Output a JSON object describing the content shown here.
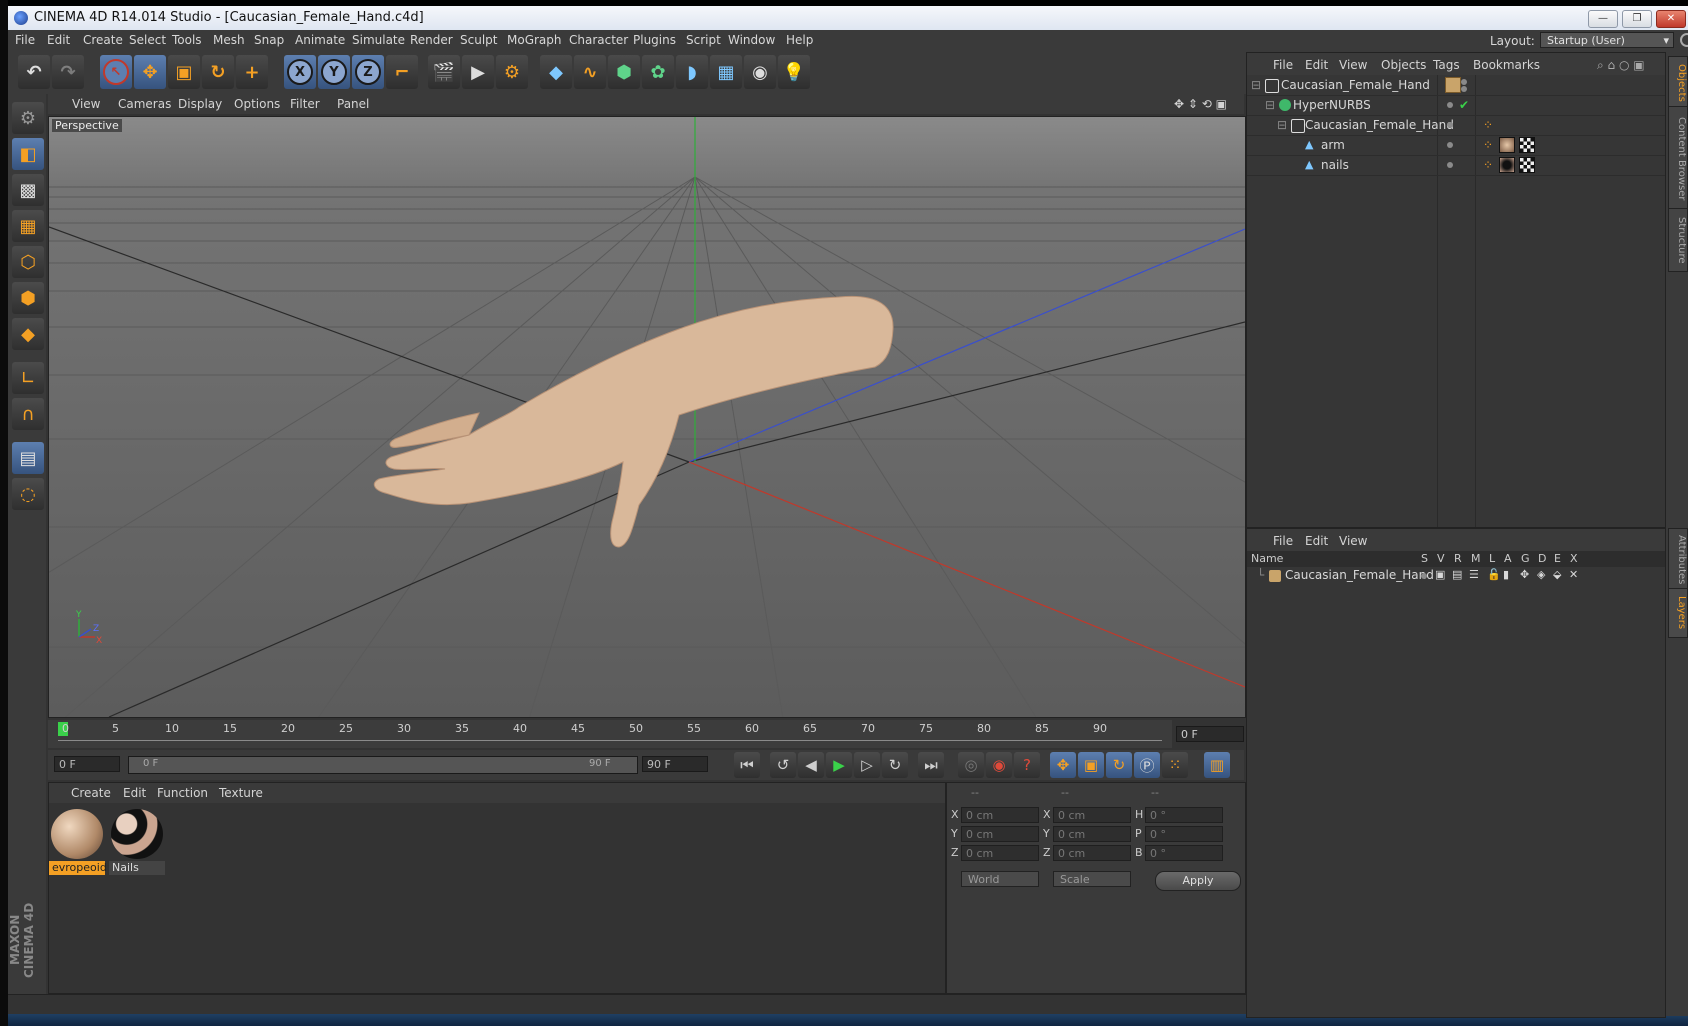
{
  "window": {
    "title": "CINEMA 4D R14.014 Studio - [Caucasian_Female_Hand.c4d]",
    "buttons": {
      "minimize": "—",
      "restore": "❐",
      "close": "✕"
    }
  },
  "menubar": {
    "items": [
      "File",
      "Edit",
      "Create",
      "Select",
      "Tools",
      "Mesh",
      "Snap",
      "Animate",
      "Simulate",
      "Render",
      "Sculpt",
      "MoGraph",
      "Character",
      "Plugins",
      "Script",
      "Window",
      "Help"
    ],
    "layout_label": "Layout:",
    "layout_value": "Startup (User)"
  },
  "toolbar": {
    "icons": [
      "undo-icon",
      "redo-icon",
      "live-selection-icon",
      "move-icon",
      "scale-icon",
      "rotate-icon",
      "add-icon",
      "x-axis-lock-icon",
      "y-axis-lock-icon",
      "z-axis-lock-icon",
      "coordinate-system-icon",
      "render-view-icon",
      "render-picture-viewer-icon",
      "render-settings-icon",
      "cube-icon",
      "spline-icon",
      "nurbs-icon",
      "array-icon",
      "deformer-icon",
      "scene-icon",
      "camera-icon",
      "light-icon"
    ],
    "axis_labels": {
      "x": "X",
      "y": "Y",
      "z": "Z"
    }
  },
  "lefttools": {
    "icons": [
      "model-mode-icon",
      "texture-mode-icon",
      "workplane-icon",
      "points-mode-icon",
      "edges-mode-icon",
      "polygons-mode-icon",
      "axis-mode-icon",
      "magnet-icon",
      "snap-grid-icon",
      "workplane-lock-icon"
    ]
  },
  "branding": {
    "logo_text": "MAXON CINEMA 4D"
  },
  "viewport": {
    "menu": [
      "View",
      "Cameras",
      "Display",
      "Options",
      "Filter",
      "Panel"
    ],
    "label": "Perspective",
    "axis_labels": {
      "y": "Y",
      "x": "X",
      "z": "Z"
    }
  },
  "timeline": {
    "ticks": [
      "0",
      "5",
      "10",
      "15",
      "20",
      "25",
      "30",
      "35",
      "40",
      "45",
      "50",
      "55",
      "60",
      "65",
      "70",
      "75",
      "80",
      "85",
      "90"
    ],
    "current_frame": "0 F"
  },
  "transport": {
    "start_field": "0 F",
    "range_start": "0 F",
    "range_end": "90 F",
    "end_field": "90 F"
  },
  "materials": {
    "menu": [
      "Create",
      "Edit",
      "Function",
      "Texture"
    ],
    "items": [
      {
        "name": "evropeoid",
        "selected": true
      },
      {
        "name": "Nails",
        "selected": false
      }
    ]
  },
  "coordinates": {
    "headers": [
      "--",
      "--",
      "--"
    ],
    "rows": [
      {
        "l1": "X",
        "v1": "0 cm",
        "l2": "X",
        "v2": "0 cm",
        "l3": "H",
        "v3": "0 °"
      },
      {
        "l1": "Y",
        "v1": "0 cm",
        "l2": "Y",
        "v2": "0 cm",
        "l3": "P",
        "v3": "0 °"
      },
      {
        "l1": "Z",
        "v1": "0 cm",
        "l2": "Z",
        "v2": "0 cm",
        "l3": "B",
        "v3": "0 °"
      }
    ],
    "space_mode": "World",
    "scale_mode": "Scale",
    "apply_label": "Apply"
  },
  "object_manager": {
    "menu": [
      "File",
      "Edit",
      "View",
      "Objects",
      "Tags",
      "Bookmarks"
    ],
    "objects": [
      {
        "name": "Caucasian_Female_Hand",
        "indent": 0
      },
      {
        "name": "HyperNURBS",
        "indent": 1
      },
      {
        "name": "Caucasian_Female_Hand",
        "indent": 2
      },
      {
        "name": "arm",
        "indent": 3
      },
      {
        "name": "nails",
        "indent": 3
      }
    ]
  },
  "layer_manager": {
    "menu": [
      "File",
      "Edit",
      "View"
    ],
    "columns": [
      "Name",
      "S",
      "V",
      "R",
      "M",
      "L",
      "A",
      "G",
      "D",
      "E",
      "X"
    ],
    "layers": [
      {
        "name": "Caucasian_Female_Hand"
      }
    ]
  },
  "side_tabs": [
    "Objects",
    "Content Browser",
    "Structure",
    "Attributes",
    "Layers"
  ],
  "colors": {
    "accent": "#f4a024",
    "panel_bg": "#333333",
    "selection_blue": "#5d7fb0",
    "x_axis": "#c0392b",
    "y_axis": "#3aa544",
    "z_axis": "#3a4fcc",
    "skin": "#d9b89a"
  }
}
